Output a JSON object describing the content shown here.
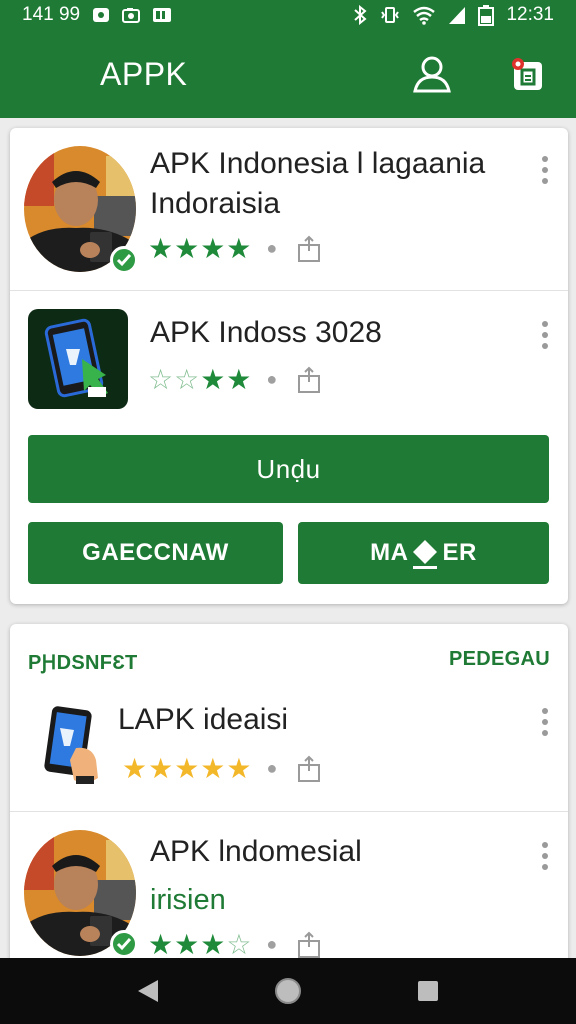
{
  "status_bar": {
    "left_text": "141 99",
    "time": "12:31"
  },
  "app_bar": {
    "title": "APPK"
  },
  "card1": {
    "items": [
      {
        "title": "APK Indonesia l lagaania Indoraisia",
        "rating": 4,
        "max_rating": 4,
        "icon": "person-avatar-verified"
      },
      {
        "title": "APK Indoss 3028",
        "rating": 2,
        "max_rating": 4,
        "icon": "phone-download-icon"
      }
    ],
    "primary_button": "Unḍu",
    "secondary_buttons": [
      "GAECCNAW",
      "MA",
      "ER"
    ]
  },
  "card2": {
    "section_left": "PԨDSNFԐT",
    "section_right": "PEDEGAU",
    "items": [
      {
        "title": "LAPK ideaisi",
        "rating": 5,
        "max_rating": 5,
        "icon": "phone-hand-icon"
      },
      {
        "title": "APK lndomesial",
        "subtitle": "irisien",
        "rating": 3,
        "max_rating": 4,
        "icon": "person-avatar-verified"
      }
    ]
  },
  "colors": {
    "primary": "#1e7a34",
    "star_gold": "#f3b72a",
    "nav_bar": "#0c0c0c"
  }
}
